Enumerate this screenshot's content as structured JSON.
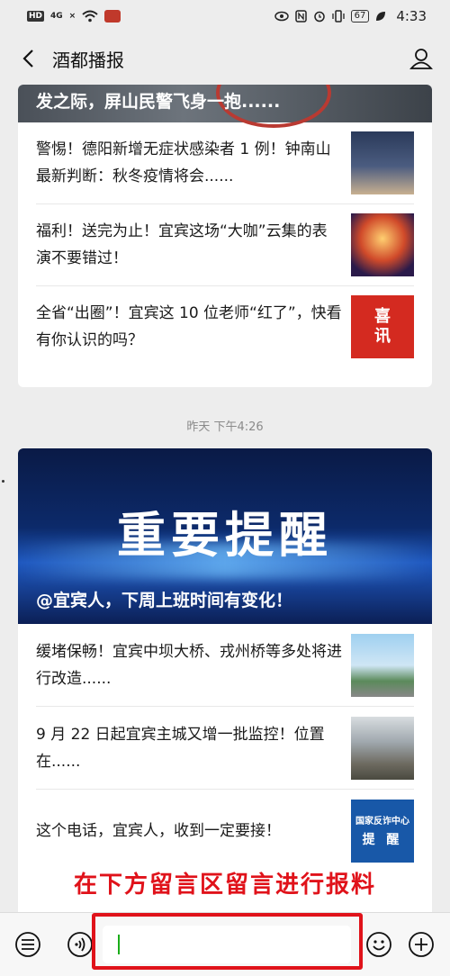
{
  "status_bar": {
    "left_badges": [
      "HD",
      "4G",
      "×"
    ],
    "battery": "67",
    "time": "4:33"
  },
  "nav": {
    "title": "酒都播报"
  },
  "card1": {
    "hero_title": "发之际，屏山民警飞身一抱......",
    "items": [
      {
        "text": "警惕！德阳新增无症状感染者 1 例！钟南山最新判断：秋冬疫情将会......"
      },
      {
        "text": "福利！送完为止！宜宾这场“大咖”云集的表演不要错过！"
      },
      {
        "text": "全省“出圈”！宜宾这 10 位老师“红了”，快看有你认识的吗？",
        "thumb_text": [
          "喜",
          "讯"
        ]
      }
    ]
  },
  "timestamp": "昨天 下午4:26",
  "card2": {
    "hero_big": "重要提醒",
    "hero_sub": "@宜宾人，下周上班时间有变化！",
    "items": [
      {
        "text": "缓堵保畅！宜宾中坝大桥、戎州桥等多处将进行改造......"
      },
      {
        "text": "9 月 22 日起宜宾主城又增一批监控！位置在......"
      },
      {
        "text": "这个电话，宜宾人，收到一定要接！",
        "thumb_text": [
          "国家反诈中心",
          "提 醒"
        ]
      }
    ]
  },
  "annotation": "在下方留言区留言进行报料",
  "colors": {
    "accent_red": "#e0121a",
    "caret_green": "#1aad19",
    "bg": "#ededed"
  },
  "icons": [
    "back-arrow-icon",
    "user-icon",
    "menu-list-icon",
    "voice-icon",
    "emoji-icon",
    "plus-icon"
  ]
}
